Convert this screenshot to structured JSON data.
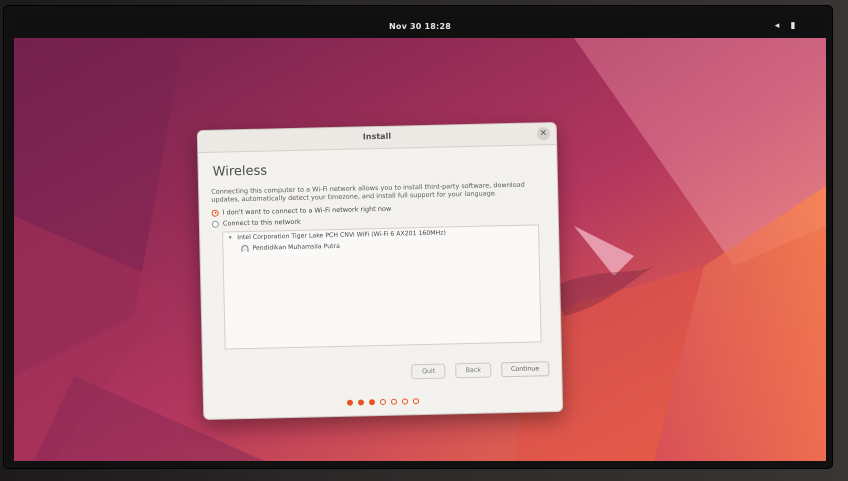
{
  "topbar": {
    "clock": "Nov 30  18:28",
    "icons": [
      "volume-icon",
      "battery-icon"
    ]
  },
  "window": {
    "title": "Install",
    "page_title": "Wireless",
    "description": "Connecting this computer to a Wi-Fi network allows you to install third-party software, download updates, automatically detect your timezone, and install full support for your language.",
    "options": [
      {
        "label": "I don't want to connect to a Wi-Fi network right now",
        "checked": true
      },
      {
        "label": "Connect to this network",
        "checked": false
      }
    ],
    "network_list": {
      "device": "Intel Corporation Tiger Lake PCH CNVi WiFi (Wi-Fi 6 AX201 160MHz)",
      "networks": [
        "Pendidikan Muhamsila Putra"
      ]
    },
    "buttons": {
      "quit": "Quit",
      "back": "Back",
      "continue": "Continue"
    },
    "pager": {
      "total": 7,
      "active": 3
    }
  },
  "colors": {
    "accent": "#e95420",
    "topbar": "#101010"
  }
}
